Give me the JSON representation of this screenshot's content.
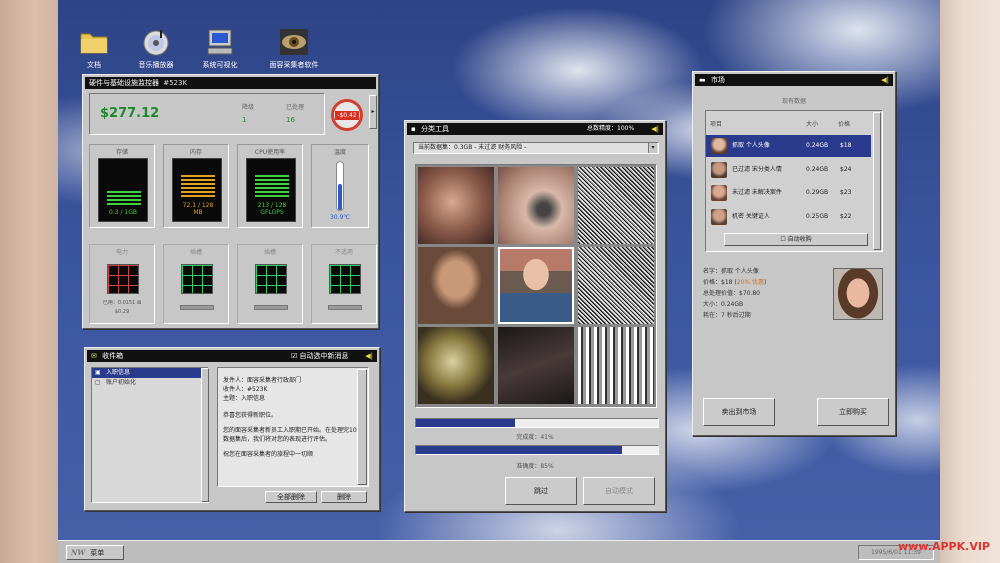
{
  "desktop": {
    "icons": [
      {
        "label": "文档",
        "icon": "folder-icon"
      },
      {
        "label": "音乐播放器",
        "icon": "cd-icon"
      },
      {
        "label": "系统可视化",
        "icon": "computer-icon"
      },
      {
        "label": "面容采集者软件",
        "icon": "eye-icon"
      }
    ]
  },
  "monitor": {
    "title": "硬件与基础设施监控器",
    "title_id": "#523K",
    "balance": "$277.12",
    "rank_label": "降级",
    "rank_value": "1",
    "processed_label": "已处理",
    "processed_value": "16",
    "delta": "-$0.42",
    "storage": {
      "label": "存储",
      "value": "0.3 / 1GB"
    },
    "memory": {
      "label": "内存",
      "value": "72.1 / 128 MB"
    },
    "cpu": {
      "label": "CPU使用率",
      "value": "213 / 128 GFLOPS"
    },
    "temp": {
      "label": "温度",
      "value": "30.9℃"
    },
    "power": {
      "label": "电力",
      "used": "已用：0.0151 ⊠",
      "cost": "$0.29"
    },
    "slot2": {
      "label": "插槽"
    },
    "slot3": {
      "label": "插槽"
    },
    "slot4": {
      "label": "不适用"
    },
    "colors": {
      "green": "#3fd13f",
      "orange": "#e0a020",
      "red": "#d83020"
    }
  },
  "inbox": {
    "title": "收件箱",
    "auto_select": "自动选中新消息",
    "items": [
      {
        "label": "入职信息",
        "selected": true
      },
      {
        "label": "账户初始化",
        "selected": false
      }
    ],
    "from_label": "发件人：",
    "from_value": "面容采集者行政部门",
    "to_label": "收件人：",
    "to_value": "#523K",
    "subject_label": "主题：",
    "subject_value": "入职信息",
    "body": [
      "恭喜您获得新职位。",
      "您的面容采集者新员工入职期已开始。在处理完10个数据集后，我们将对您的表现进行评估。",
      "祝您在面容采集者的旅程中一切顺"
    ],
    "delete_all": "全部删除",
    "delete": "删除"
  },
  "classifier": {
    "title": "分类工具",
    "accuracy_label": "总数精度：100%",
    "dropdown": "当前数据集：0.3GB - 未过滤 财务风险 -",
    "progress1_label": "完成度：41%",
    "progress1": 0.41,
    "progress2_label": "准确度：85%",
    "progress2": 0.85,
    "skip": "跳过",
    "auto": "自动模式"
  },
  "market": {
    "title": "市场",
    "section": "现有数据",
    "col_item": "项目",
    "col_size": "大小",
    "col_price": "价格",
    "rows": [
      {
        "name": "抓取 个人头像",
        "size": "0.24GB",
        "price": "$18",
        "selected": true
      },
      {
        "name": "已过滤 宋分类人情",
        "size": "0.24GB",
        "price": "$24",
        "selected": false
      },
      {
        "name": "未过滤 未解决案件",
        "size": "0.29GB",
        "price": "$23",
        "selected": false
      },
      {
        "name": "机密 关键证人",
        "size": "0.25GB",
        "price": "$22",
        "selected": false
      }
    ],
    "auto_buy": "自动收购",
    "detail_name": "名字：抓取 个人头像",
    "detail_price": "价格：$18 (",
    "detail_price_note": "20% 优惠",
    "detail_price_end": ")",
    "detail_value": "总处理价值：$70.80",
    "detail_size": "大小：0.24GB",
    "detail_expire": "耗在：7 秒后过期",
    "sell": "卖出到市场",
    "buy": "立即购买"
  },
  "taskbar": {
    "start_logo": "NW",
    "start": "菜单",
    "clock": "1995/6/01 11:39"
  },
  "watermark": "www.APPK.VIP"
}
